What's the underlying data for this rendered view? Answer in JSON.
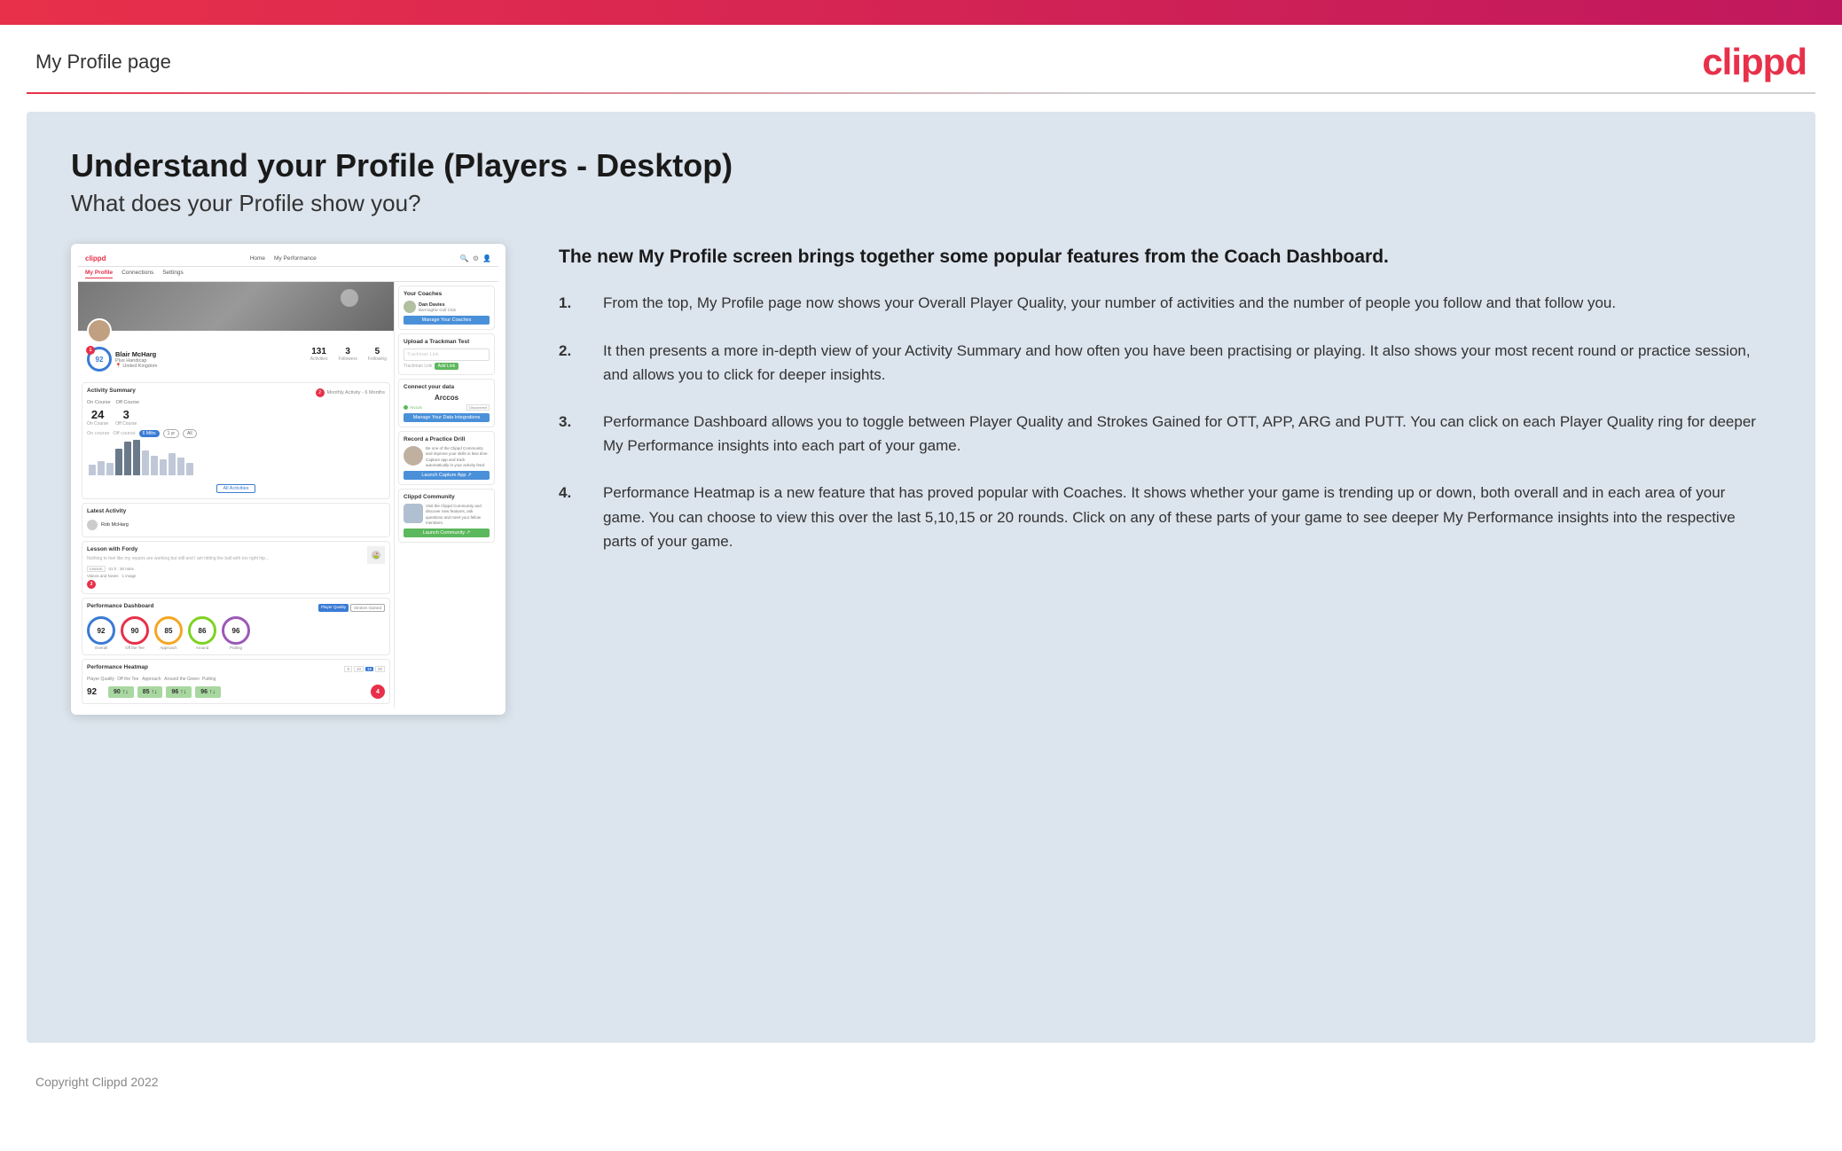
{
  "topbar": {},
  "header": {
    "title": "My Profile page",
    "logo": "clippd"
  },
  "divider": {},
  "main": {
    "bg_color": "#dce4ed",
    "title": "Understand your Profile (Players - Desktop)",
    "subtitle": "What does your Profile show you?",
    "highlight": "The new My Profile screen brings together some popular features from the Coach Dashboard.",
    "list_items": [
      {
        "id": 1,
        "text": "From the top, My Profile page now shows your Overall Player Quality, your number of activities and the number of people you follow and that follow you."
      },
      {
        "id": 2,
        "text": "It then presents a more in-depth view of your Activity Summary and how often you have been practising or playing. It also shows your most recent round or practice session, and allows you to click for deeper insights."
      },
      {
        "id": 3,
        "text": "Performance Dashboard allows you to toggle between Player Quality and Strokes Gained for OTT, APP, ARG and PUTT. You can click on each Player Quality ring for deeper My Performance insights into each part of your game."
      },
      {
        "id": 4,
        "text": "Performance Heatmap is a new feature that has proved popular with Coaches. It shows whether your game is trending up or down, both overall and in each area of your game. You can choose to view this over the last 5,10,15 or 20 rounds. Click on any of these parts of your game to see deeper My Performance insights into the respective parts of your game."
      }
    ],
    "mockup": {
      "nav": {
        "logo": "clippd",
        "links": [
          "Home",
          "My Performance"
        ],
        "subnav": [
          "My Profile",
          "Connections",
          "Settings"
        ]
      },
      "player": {
        "name": "Blair McHarg",
        "handicap": "Plus Handicap",
        "location": "United Kingdom",
        "pq": "92",
        "activities": "131",
        "followers": "3",
        "following": "5"
      },
      "activity": {
        "on_course": "24",
        "off_course": "3",
        "title": "Monthly Activity - 6 Months",
        "bars": [
          15,
          20,
          18,
          35,
          40,
          45,
          30,
          25,
          20,
          28,
          22,
          15
        ]
      },
      "latest_activity": {
        "title": "Latest Activity",
        "user": "Rob McHarg",
        "lesson": {
          "title": "Lesson with Fordy",
          "duration": "01h: 30 mins",
          "videos": "1"
        }
      },
      "performance": {
        "title": "Performance Dashboard",
        "circles": [
          {
            "label": "Overall",
            "value": "92",
            "color": "#3a7bd5"
          },
          {
            "label": "Off the Tee",
            "value": "90",
            "color": "#e8304a"
          },
          {
            "label": "Approach",
            "value": "85",
            "color": "#f5a623"
          },
          {
            "label": "Around the Green",
            "value": "86",
            "color": "#7ed321"
          },
          {
            "label": "Putting",
            "value": "96",
            "color": "#9b59b6"
          }
        ]
      },
      "heatmap": {
        "title": "Performance Heatmap",
        "overall": "92",
        "cells": [
          "90 ↑↓",
          "85 ↑↓",
          "96 ↑↓",
          "96 ↑↓"
        ]
      },
      "coaches": {
        "title": "Your Coaches",
        "coach": "Dan Davies",
        "club": "Barrnaghie Golf Club",
        "btn": "Manage Your Coaches"
      },
      "trackman": {
        "title": "Upload a Trackman Test",
        "placeholder": "Trackman Link",
        "btn": "Add Link"
      },
      "connect": {
        "title": "Connect your data",
        "app": "Arccos",
        "btn": "Manage Your Data Integrations"
      },
      "drill": {
        "title": "Record a Practice Drill",
        "btn": "Launch Capture App"
      },
      "community": {
        "title": "Clippd Community",
        "btn": "Launch Community"
      }
    }
  },
  "footer": {
    "text": "Copyright Clippd 2022"
  }
}
